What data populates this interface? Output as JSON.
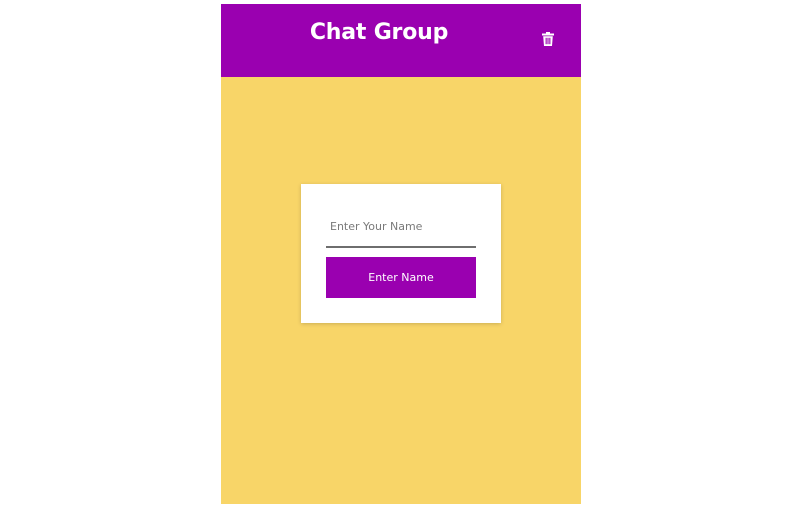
{
  "header": {
    "title": "Chat Group",
    "delete_icon": "trash-icon"
  },
  "form": {
    "name_placeholder": "Enter Your Name",
    "name_value": "",
    "submit_label": "Enter Name"
  },
  "colors": {
    "header_bg": "#9a00b0",
    "app_bg": "#f8d568",
    "button_bg": "#9a00b0",
    "card_bg": "#ffffff"
  }
}
